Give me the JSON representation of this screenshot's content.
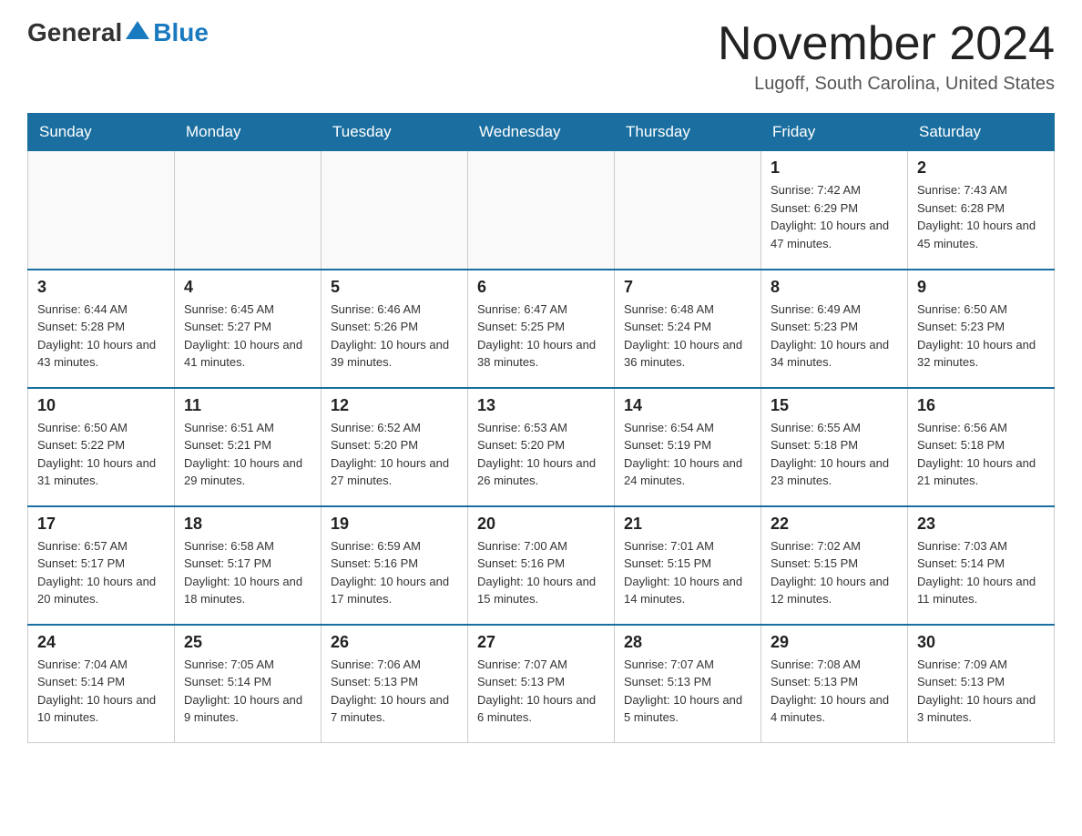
{
  "logo": {
    "text_general": "General",
    "text_blue": "Blue"
  },
  "title": "November 2024",
  "subtitle": "Lugoff, South Carolina, United States",
  "days_of_week": [
    "Sunday",
    "Monday",
    "Tuesday",
    "Wednesday",
    "Thursday",
    "Friday",
    "Saturday"
  ],
  "weeks": [
    [
      {
        "day": "",
        "info": ""
      },
      {
        "day": "",
        "info": ""
      },
      {
        "day": "",
        "info": ""
      },
      {
        "day": "",
        "info": ""
      },
      {
        "day": "",
        "info": ""
      },
      {
        "day": "1",
        "info": "Sunrise: 7:42 AM\nSunset: 6:29 PM\nDaylight: 10 hours and 47 minutes."
      },
      {
        "day": "2",
        "info": "Sunrise: 7:43 AM\nSunset: 6:28 PM\nDaylight: 10 hours and 45 minutes."
      }
    ],
    [
      {
        "day": "3",
        "info": "Sunrise: 6:44 AM\nSunset: 5:28 PM\nDaylight: 10 hours and 43 minutes."
      },
      {
        "day": "4",
        "info": "Sunrise: 6:45 AM\nSunset: 5:27 PM\nDaylight: 10 hours and 41 minutes."
      },
      {
        "day": "5",
        "info": "Sunrise: 6:46 AM\nSunset: 5:26 PM\nDaylight: 10 hours and 39 minutes."
      },
      {
        "day": "6",
        "info": "Sunrise: 6:47 AM\nSunset: 5:25 PM\nDaylight: 10 hours and 38 minutes."
      },
      {
        "day": "7",
        "info": "Sunrise: 6:48 AM\nSunset: 5:24 PM\nDaylight: 10 hours and 36 minutes."
      },
      {
        "day": "8",
        "info": "Sunrise: 6:49 AM\nSunset: 5:23 PM\nDaylight: 10 hours and 34 minutes."
      },
      {
        "day": "9",
        "info": "Sunrise: 6:50 AM\nSunset: 5:23 PM\nDaylight: 10 hours and 32 minutes."
      }
    ],
    [
      {
        "day": "10",
        "info": "Sunrise: 6:50 AM\nSunset: 5:22 PM\nDaylight: 10 hours and 31 minutes."
      },
      {
        "day": "11",
        "info": "Sunrise: 6:51 AM\nSunset: 5:21 PM\nDaylight: 10 hours and 29 minutes."
      },
      {
        "day": "12",
        "info": "Sunrise: 6:52 AM\nSunset: 5:20 PM\nDaylight: 10 hours and 27 minutes."
      },
      {
        "day": "13",
        "info": "Sunrise: 6:53 AM\nSunset: 5:20 PM\nDaylight: 10 hours and 26 minutes."
      },
      {
        "day": "14",
        "info": "Sunrise: 6:54 AM\nSunset: 5:19 PM\nDaylight: 10 hours and 24 minutes."
      },
      {
        "day": "15",
        "info": "Sunrise: 6:55 AM\nSunset: 5:18 PM\nDaylight: 10 hours and 23 minutes."
      },
      {
        "day": "16",
        "info": "Sunrise: 6:56 AM\nSunset: 5:18 PM\nDaylight: 10 hours and 21 minutes."
      }
    ],
    [
      {
        "day": "17",
        "info": "Sunrise: 6:57 AM\nSunset: 5:17 PM\nDaylight: 10 hours and 20 minutes."
      },
      {
        "day": "18",
        "info": "Sunrise: 6:58 AM\nSunset: 5:17 PM\nDaylight: 10 hours and 18 minutes."
      },
      {
        "day": "19",
        "info": "Sunrise: 6:59 AM\nSunset: 5:16 PM\nDaylight: 10 hours and 17 minutes."
      },
      {
        "day": "20",
        "info": "Sunrise: 7:00 AM\nSunset: 5:16 PM\nDaylight: 10 hours and 15 minutes."
      },
      {
        "day": "21",
        "info": "Sunrise: 7:01 AM\nSunset: 5:15 PM\nDaylight: 10 hours and 14 minutes."
      },
      {
        "day": "22",
        "info": "Sunrise: 7:02 AM\nSunset: 5:15 PM\nDaylight: 10 hours and 12 minutes."
      },
      {
        "day": "23",
        "info": "Sunrise: 7:03 AM\nSunset: 5:14 PM\nDaylight: 10 hours and 11 minutes."
      }
    ],
    [
      {
        "day": "24",
        "info": "Sunrise: 7:04 AM\nSunset: 5:14 PM\nDaylight: 10 hours and 10 minutes."
      },
      {
        "day": "25",
        "info": "Sunrise: 7:05 AM\nSunset: 5:14 PM\nDaylight: 10 hours and 9 minutes."
      },
      {
        "day": "26",
        "info": "Sunrise: 7:06 AM\nSunset: 5:13 PM\nDaylight: 10 hours and 7 minutes."
      },
      {
        "day": "27",
        "info": "Sunrise: 7:07 AM\nSunset: 5:13 PM\nDaylight: 10 hours and 6 minutes."
      },
      {
        "day": "28",
        "info": "Sunrise: 7:07 AM\nSunset: 5:13 PM\nDaylight: 10 hours and 5 minutes."
      },
      {
        "day": "29",
        "info": "Sunrise: 7:08 AM\nSunset: 5:13 PM\nDaylight: 10 hours and 4 minutes."
      },
      {
        "day": "30",
        "info": "Sunrise: 7:09 AM\nSunset: 5:13 PM\nDaylight: 10 hours and 3 minutes."
      }
    ]
  ]
}
